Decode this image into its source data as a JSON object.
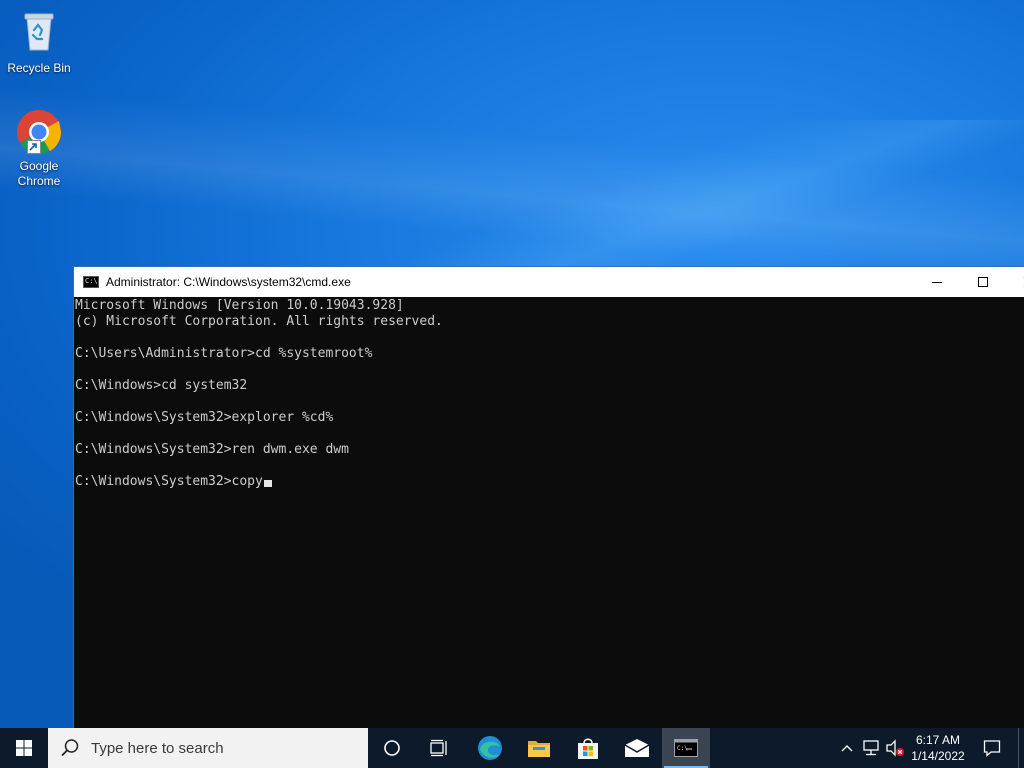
{
  "desktop": {
    "icons": [
      {
        "label": "Recycle Bin",
        "icon": "recycle-bin-icon"
      },
      {
        "label": "Google Chrome",
        "icon": "chrome-icon"
      }
    ]
  },
  "cmd_window": {
    "title": "Administrator: C:\\Windows\\system32\\cmd.exe",
    "lines": [
      "Microsoft Windows [Version 10.0.19043.928]",
      "(c) Microsoft Corporation. All rights reserved.",
      "",
      "C:\\Users\\Administrator>cd %systemroot%",
      "",
      "C:\\Windows>cd system32",
      "",
      "C:\\Windows\\System32>explorer %cd%",
      "",
      "C:\\Windows\\System32>ren dwm.exe dwm",
      ""
    ],
    "prompt_line": "C:\\Windows\\System32>copy",
    "colors": {
      "background": "#0c0c0c",
      "text": "#cccccc"
    }
  },
  "taskbar": {
    "search_placeholder": "Type here to search",
    "pinned": [
      "cortana-icon",
      "task-view-icon",
      "edge-icon",
      "file-explorer-icon",
      "store-icon",
      "mail-icon",
      "cmd-icon"
    ],
    "tray": {
      "time": "6:17 AM",
      "date": "1/14/2022",
      "icons": [
        "show-hidden-icons-icon",
        "network-icon",
        "volume-muted-icon",
        "notification-icon"
      ]
    },
    "colors": {
      "background": "#0d1a2b",
      "accent": "#79b8f0"
    }
  }
}
